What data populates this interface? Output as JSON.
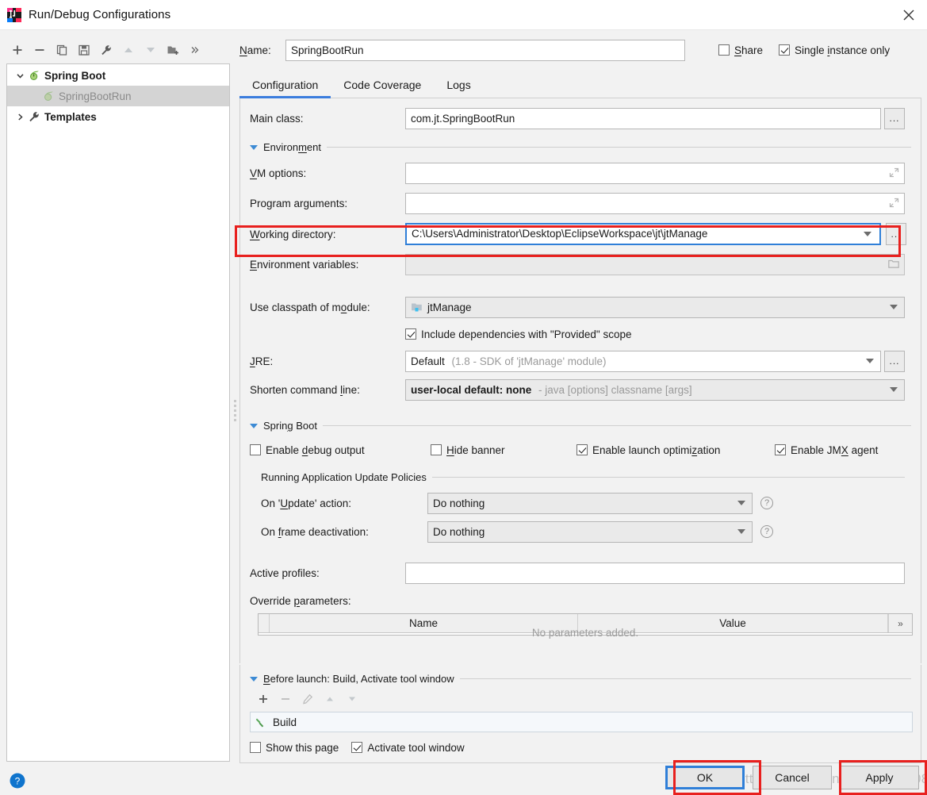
{
  "window": {
    "title": "Run/Debug Configurations",
    "app_icon": "intellij-idea-icon",
    "close_icon": "close-icon"
  },
  "toolbar": {
    "buttons": [
      {
        "name": "add-configuration-button",
        "icon": "plus-icon",
        "enabled": true
      },
      {
        "name": "remove-configuration-button",
        "icon": "minus-icon",
        "enabled": true
      },
      {
        "name": "copy-configuration-button",
        "icon": "copy-icon",
        "enabled": true
      },
      {
        "name": "save-configuration-button",
        "icon": "save-icon",
        "enabled": true
      },
      {
        "name": "edit-templates-button",
        "icon": "wrench-icon",
        "enabled": true
      },
      {
        "name": "move-up-button",
        "icon": "arrow-up-icon",
        "enabled": false
      },
      {
        "name": "move-down-button",
        "icon": "arrow-down-icon",
        "enabled": false
      },
      {
        "name": "new-folder-button",
        "icon": "folder-add-icon",
        "enabled": true
      },
      {
        "name": "more-button",
        "icon": "chevron-double-right-icon",
        "enabled": true
      }
    ]
  },
  "tree": {
    "items": [
      {
        "label": "Spring Boot",
        "icon": "spring-boot-icon",
        "expanded": true,
        "level": 0,
        "bold": true,
        "selected": false
      },
      {
        "label": "SpringBootRun",
        "icon": "spring-boot-icon",
        "level": 1,
        "bold": false,
        "selected": true,
        "muted": true
      },
      {
        "label": "Templates",
        "icon": "wrench-icon",
        "expanded": false,
        "level": 0,
        "bold": true,
        "selected": false
      }
    ]
  },
  "name_row": {
    "label": "Name:",
    "value": "SpringBootRun",
    "share": {
      "label": "Share",
      "checked": false
    },
    "single_instance": {
      "label": "Single instance only",
      "checked": true
    }
  },
  "tabs": [
    {
      "label": "Configuration",
      "active": true
    },
    {
      "label": "Code Coverage",
      "active": false
    },
    {
      "label": "Logs",
      "active": false
    }
  ],
  "form": {
    "main_class": {
      "label": "Main class:",
      "value": "com.jt.SpringBootRun",
      "browse": "..."
    },
    "environment_section": {
      "label": "Environment",
      "expanded": true
    },
    "vm_options": {
      "label": "VM options:",
      "value": ""
    },
    "program_arguments": {
      "label": "Program arguments:",
      "value": ""
    },
    "working_directory": {
      "label": "Working directory:",
      "value": "C:\\Users\\Administrator\\Desktop\\EclipseWorkspace\\jt\\jtManage",
      "browse": "...",
      "focused": true,
      "highlighted": true
    },
    "environment_variables": {
      "label": "Environment variables:",
      "value": ""
    },
    "use_classpath_of_module": {
      "label": "Use classpath of module:",
      "value": "jtManage",
      "icon": "module-icon"
    },
    "include_provided": {
      "label": "Include dependencies with \"Provided\" scope",
      "checked": true
    },
    "jre": {
      "label": "JRE:",
      "value": "Default",
      "hint": "(1.8 - SDK of 'jtManage' module)",
      "browse": "..."
    },
    "shorten_command_line": {
      "label": "Shorten command line:",
      "value": "user-local default: none",
      "hint": "- java [options] classname [args]"
    },
    "spring_boot_section": {
      "label": "Spring Boot",
      "expanded": true
    },
    "spring_checks": [
      {
        "label": "Enable debug output",
        "checked": false,
        "accel": "d"
      },
      {
        "label": "Hide banner",
        "checked": false,
        "accel": "H"
      },
      {
        "label": "Enable launch optimization",
        "checked": true,
        "accel": "z"
      },
      {
        "label": "Enable JMX agent",
        "checked": true,
        "accel": "X"
      }
    ],
    "update_policies": {
      "title": "Running Application Update Policies",
      "on_update_action": {
        "label": "On 'Update' action:",
        "value": "Do nothing",
        "help": "?"
      },
      "on_frame_deactivation": {
        "label": "On frame deactivation:",
        "value": "Do nothing",
        "help": "?"
      }
    },
    "active_profiles": {
      "label": "Active profiles:",
      "value": ""
    },
    "override_parameters": {
      "label": "Override parameters:",
      "columns": [
        "Name",
        "Value"
      ],
      "empty_text": "No parameters added.",
      "more": "»"
    }
  },
  "before_launch": {
    "section_label": "Before launch: Build, Activate tool window",
    "expanded": true,
    "toolbar": [
      {
        "name": "add-task-button",
        "icon": "plus-icon",
        "enabled": true
      },
      {
        "name": "remove-task-button",
        "icon": "minus-icon",
        "enabled": false
      },
      {
        "name": "edit-task-button",
        "icon": "pencil-icon",
        "enabled": false
      },
      {
        "name": "task-move-up-button",
        "icon": "arrow-up-icon",
        "enabled": false
      },
      {
        "name": "task-move-down-button",
        "icon": "arrow-down-icon",
        "enabled": false
      }
    ],
    "tasks": [
      {
        "label": "Build",
        "icon": "hammer-icon"
      }
    ],
    "show_this_page": {
      "label": "Show this page",
      "checked": false
    },
    "activate_tool_window": {
      "label": "Activate tool window",
      "checked": true
    }
  },
  "footer": {
    "help_icon": "help-circle-icon",
    "buttons": [
      {
        "label": "OK",
        "name": "ok-button",
        "focused": true,
        "highlighted": true
      },
      {
        "label": "Cancel",
        "name": "cancel-button",
        "focused": false,
        "highlighted": false
      },
      {
        "label": "Apply",
        "name": "apply-button",
        "focused": false,
        "highlighted": true
      }
    ]
  },
  "watermark": "https://blog.csdn.net/qq_40808",
  "colors": {
    "accent": "#3b7ddd",
    "focus_border": "#2f7fd8",
    "annotation_red": "#e8201e",
    "panel_bg": "#f2f2f2",
    "field_bg": "#ffffff",
    "disabled_bg": "#eaeaea"
  }
}
